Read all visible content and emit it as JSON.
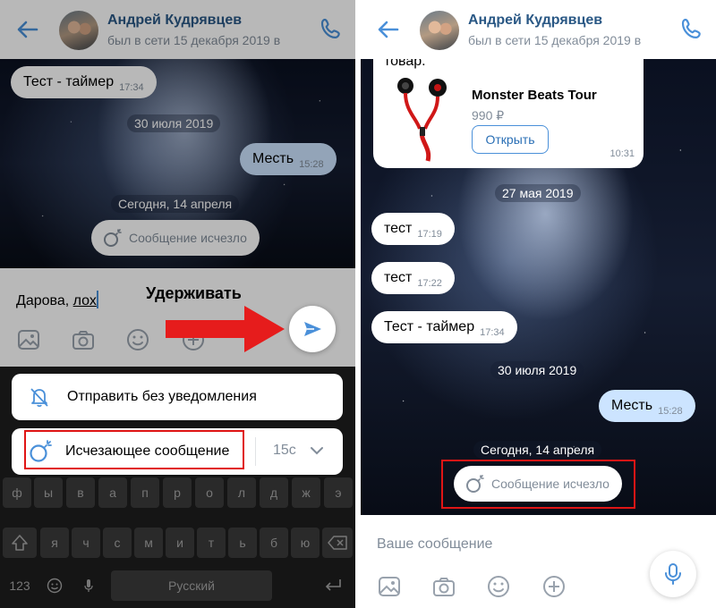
{
  "left": {
    "header": {
      "name": "Андрей Кудрявцев",
      "status": "был в сети 15 декабря 2019 в"
    },
    "messages": [
      {
        "text": "Тест - таймер",
        "time": "17:34"
      },
      {
        "text": "Месть",
        "time": "15:28"
      }
    ],
    "dates": [
      "30 июля 2019",
      "Сегодня, 14 апреля"
    ],
    "disappeared": "Сообщение исчезло",
    "compose": {
      "text_before": "Дарова, ",
      "text_underlined": "лох"
    },
    "annotation": "Удерживать",
    "menu": {
      "silent": "Отправить без уведомления",
      "disappearing": "Исчезающее сообщение",
      "timer": "15с"
    },
    "keyboard": {
      "row_top": [
        "ф",
        "ы",
        "в",
        "а",
        "п",
        "р",
        "о",
        "л",
        "д",
        "ж",
        "э"
      ],
      "row_mid": [
        "я",
        "ч",
        "с",
        "м",
        "и",
        "т",
        "ь",
        "б",
        "ю"
      ],
      "sym": "123",
      "space": "Русский"
    }
  },
  "right": {
    "header": {
      "name": "Андрей Кудрявцев",
      "status": "был в сети 15 декабря 2019 в"
    },
    "product": {
      "caption": "товар.",
      "title": "Monster Beats Tour",
      "price": "990 ₽",
      "button": "Открыть",
      "time": "10:31"
    },
    "dates": [
      "27 мая 2019",
      "30 июля 2019",
      "Сегодня, 14 апреля"
    ],
    "messages": [
      {
        "text": "тест",
        "time": "17:19"
      },
      {
        "text": "тест",
        "time": "17:22"
      },
      {
        "text": "Тест - таймер",
        "time": "17:34"
      },
      {
        "text": "Месть",
        "time": "15:28"
      }
    ],
    "disappeared": "Сообщение исчезло",
    "compose": {
      "placeholder": "Ваше сообщение"
    }
  },
  "colors": {
    "accent": "#2a5885",
    "link": "#4a90d9",
    "highlight": "#e01515",
    "out_bubble": "#cce4ff"
  }
}
